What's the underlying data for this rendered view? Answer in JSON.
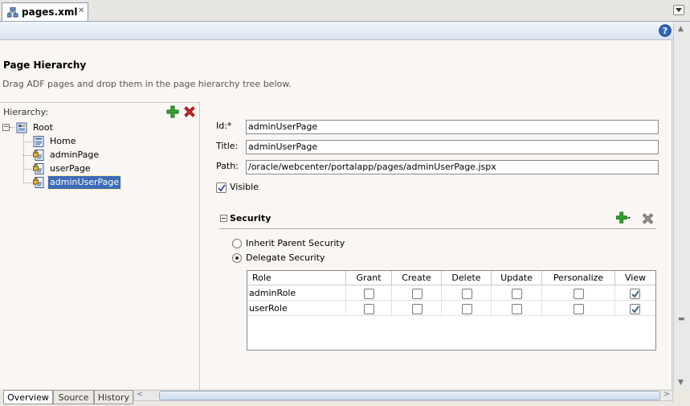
{
  "tab": {
    "title": "pages.xml",
    "close": "✕"
  },
  "header": {
    "title": "Page Hierarchy",
    "description": "Drag ADF pages and drop them in the page hierarchy tree below."
  },
  "hierarchy": {
    "label": "Hierarchy:",
    "root": "Root",
    "children": [
      "Home",
      "adminPage",
      "userPage",
      "adminUserPage"
    ],
    "selected": "adminUserPage"
  },
  "form": {
    "id_label": "Id:*",
    "id_value": "adminUserPage",
    "title_label": "Title:",
    "title_value": "adminUserPage",
    "path_label": "Path:",
    "path_value": "/oracle/webcenter/portalapp/pages/adminUserPage.jspx",
    "visible_label": "Visible",
    "visible_checked": true
  },
  "security": {
    "title": "Security",
    "options": [
      "Inherit Parent Security",
      "Delegate Security"
    ],
    "selected_option": "Delegate Security",
    "columns": [
      "Role",
      "Grant",
      "Create",
      "Delete",
      "Update",
      "Personalize",
      "View"
    ],
    "rows": [
      {
        "role": "adminRole",
        "grant": false,
        "create": false,
        "delete": false,
        "update": false,
        "personalize": false,
        "view": true
      },
      {
        "role": "userRole",
        "grant": false,
        "create": false,
        "delete": false,
        "update": false,
        "personalize": false,
        "view": true
      }
    ]
  },
  "bottom_tabs": [
    "Overview",
    "Source",
    "History"
  ],
  "active_bottom_tab": "Overview",
  "icons": {
    "file": "xml-file-icon",
    "help": "help-icon",
    "add": "green-plus-icon",
    "delete": "red-x-icon",
    "page": "page-icon",
    "secured_page": "locked-page-icon"
  },
  "colors": {
    "selection": "#3d6bb5",
    "editor_bg": "#faf6f3",
    "add_green": "#2ea52e",
    "delete_red": "#d42a2a"
  }
}
